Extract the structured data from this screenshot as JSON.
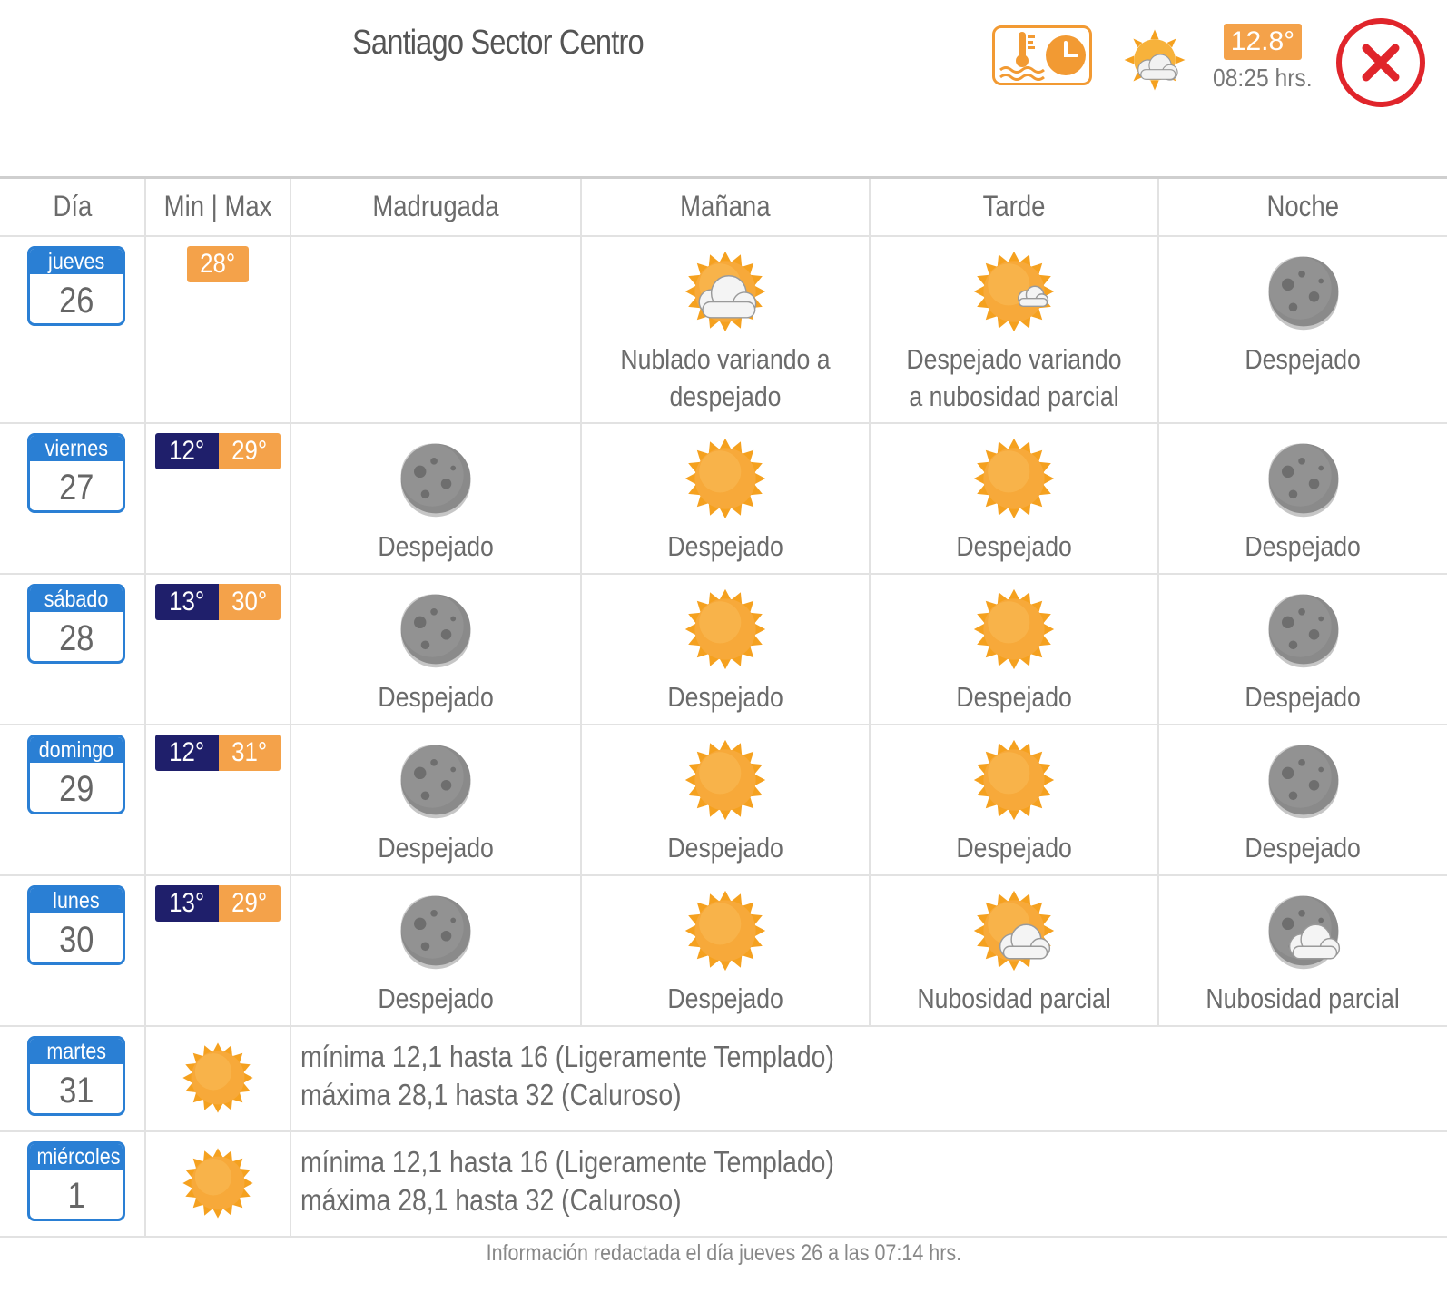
{
  "header": {
    "title": "Santiago Sector Centro",
    "current_temp": "12.8°",
    "current_time": "08:25 hrs.",
    "current_icon": "partly-cloudy-sun-icon"
  },
  "columns": [
    "Día",
    "Min | Max",
    "Madrugada",
    "Mañana",
    "Tarde",
    "Noche"
  ],
  "days": [
    {
      "name": "jueves",
      "num": "26",
      "min": "",
      "max": "28°",
      "periods": [
        {
          "icon": "",
          "desc": ""
        },
        {
          "icon": "cloudy-sun",
          "desc": "Nublado variando a despejado"
        },
        {
          "icon": "sun-small-cloud",
          "desc": "Despejado variando a nubosidad parcial"
        },
        {
          "icon": "moon",
          "desc": "Despejado"
        }
      ]
    },
    {
      "name": "viernes",
      "num": "27",
      "min": "12°",
      "max": "29°",
      "periods": [
        {
          "icon": "moon",
          "desc": "Despejado"
        },
        {
          "icon": "sun",
          "desc": "Despejado"
        },
        {
          "icon": "sun",
          "desc": "Despejado"
        },
        {
          "icon": "moon",
          "desc": "Despejado"
        }
      ]
    },
    {
      "name": "sábado",
      "num": "28",
      "min": "13°",
      "max": "30°",
      "periods": [
        {
          "icon": "moon",
          "desc": "Despejado"
        },
        {
          "icon": "sun",
          "desc": "Despejado"
        },
        {
          "icon": "sun",
          "desc": "Despejado"
        },
        {
          "icon": "moon",
          "desc": "Despejado"
        }
      ]
    },
    {
      "name": "domingo",
      "num": "29",
      "min": "12°",
      "max": "31°",
      "periods": [
        {
          "icon": "moon",
          "desc": "Despejado"
        },
        {
          "icon": "sun",
          "desc": "Despejado"
        },
        {
          "icon": "sun",
          "desc": "Despejado"
        },
        {
          "icon": "moon",
          "desc": "Despejado"
        }
      ]
    },
    {
      "name": "lunes",
      "num": "30",
      "min": "13°",
      "max": "29°",
      "periods": [
        {
          "icon": "moon",
          "desc": "Despejado"
        },
        {
          "icon": "sun",
          "desc": "Despejado"
        },
        {
          "icon": "sun-cloud",
          "desc": "Nubosidad parcial"
        },
        {
          "icon": "moon-cloud",
          "desc": "Nubosidad parcial"
        }
      ]
    }
  ],
  "summary_days": [
    {
      "name": "martes",
      "num": "31",
      "icon": "sun",
      "line1": "mínima 12,1 hasta 16 (Ligeramente Templado)",
      "line2": "máxima 28,1 hasta 32 (Caluroso)"
    },
    {
      "name": "miércoles",
      "num": "1",
      "icon": "sun",
      "line1": "mínima 12,1 hasta 16 (Ligeramente Templado)",
      "line2": "máxima 28,1 hasta 32 (Caluroso)"
    }
  ],
  "footer": "Información redactada el día jueves 26 a las 07:14 hrs.",
  "colors": {
    "accent_orange": "#f4a24a",
    "min_navy": "#1f1f6b",
    "calendar_blue": "#2a7fd4",
    "close_red": "#e0252b"
  }
}
